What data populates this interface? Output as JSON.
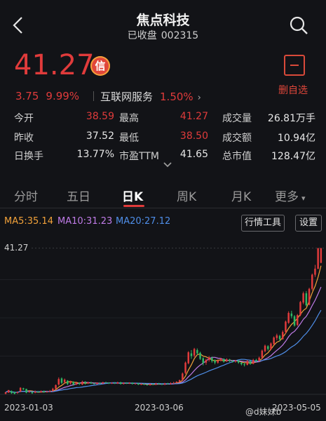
{
  "header": {
    "title": "焦点科技",
    "status": "已收盘",
    "code": "002315"
  },
  "quote": {
    "price": "41.27",
    "badge": "信",
    "change": "3.75",
    "change_pct": "9.99%",
    "sector_name": "互联网服务",
    "sector_pct": "1.50%",
    "sector_arrow": "›"
  },
  "actions": {
    "unfavorite_label": "删自选"
  },
  "stats": {
    "open_label": "今开",
    "open": "38.59",
    "high_label": "最高",
    "high": "41.27",
    "volume_label": "成交量",
    "volume": "26.81万手",
    "prev_label": "昨收",
    "prev": "37.52",
    "low_label": "最低",
    "low": "38.50",
    "amount_label": "成交额",
    "amount": "10.94亿",
    "turnover_label": "日换手",
    "turnover": "13.77%",
    "pe_label": "市盈TTM",
    "pe": "41.65",
    "mcap_label": "总市值",
    "mcap": "128.47亿"
  },
  "tabs": [
    "分时",
    "五日",
    "日K",
    "周K",
    "月K",
    "更多"
  ],
  "tabs_more_arrow": "▾",
  "active_tab": "日K",
  "indicators": {
    "ma5": "MA5:35.14",
    "ma10": "MA10:31.23",
    "ma20": "MA20:27.12"
  },
  "buttons": {
    "tools": "行情工具",
    "settings": "设置"
  },
  "watermark": "@d妹妹b",
  "colors": {
    "up": "#e03b3b",
    "down": "#2fb865",
    "ma5": "#f2a23a",
    "ma10": "#c07ce8",
    "ma20": "#4f8ee8",
    "bg": "#121317"
  },
  "chart_data": {
    "type": "candlestick",
    "price_label_top": "41.27",
    "x_tick_labels": [
      "2023-01-03",
      "2023-03-06",
      "2023-05-05"
    ],
    "ylim": [
      14.5,
      42.5
    ],
    "candles": [
      [
        14.6,
        14.9,
        14.5,
        14.6
      ],
      [
        14.8,
        15.3,
        14.9,
        15.2
      ],
      [
        15.1,
        14.7,
        14.6,
        15.2
      ],
      [
        14.9,
        14.6,
        14.5,
        15.0
      ],
      [
        14.8,
        14.9,
        14.6,
        15.0
      ],
      [
        15.0,
        15.7,
        14.9,
        15.8
      ],
      [
        15.6,
        15.4,
        15.3,
        15.7
      ],
      [
        15.5,
        14.8,
        14.7,
        15.5
      ],
      [
        15.0,
        15.0,
        14.8,
        15.2
      ],
      [
        14.9,
        14.7,
        14.6,
        15.0
      ],
      [
        14.8,
        15.0,
        14.7,
        15.2
      ],
      [
        15.0,
        14.9,
        14.8,
        15.1
      ],
      [
        14.9,
        15.1,
        14.8,
        15.2
      ],
      [
        15.1,
        14.9,
        14.8,
        15.2
      ],
      [
        14.9,
        15.0,
        14.8,
        15.1
      ],
      [
        15.0,
        15.1,
        14.9,
        15.3
      ],
      [
        15.1,
        15.5,
        15.0,
        15.7
      ],
      [
        15.5,
        16.2,
        15.4,
        16.3
      ],
      [
        16.3,
        17.3,
        16.1,
        17.6
      ],
      [
        17.4,
        16.6,
        16.4,
        17.6
      ],
      [
        16.7,
        17.2,
        16.5,
        17.4
      ],
      [
        17.0,
        16.4,
        16.2,
        17.1
      ],
      [
        16.5,
        16.9,
        16.3,
        17.0
      ],
      [
        16.8,
        16.3,
        16.1,
        16.9
      ],
      [
        16.3,
        16.6,
        16.2,
        16.8
      ],
      [
        16.6,
        16.4,
        16.2,
        16.7
      ],
      [
        16.3,
        16.8,
        16.2,
        17.0
      ],
      [
        16.8,
        16.5,
        16.3,
        16.9
      ],
      [
        16.5,
        16.7,
        16.4,
        16.8
      ],
      [
        16.7,
        16.5,
        16.4,
        16.8
      ],
      [
        16.5,
        16.4,
        16.3,
        16.6
      ],
      [
        16.4,
        16.6,
        16.3,
        16.7
      ],
      [
        16.6,
        16.5,
        16.4,
        16.7
      ],
      [
        16.5,
        16.7,
        16.4,
        16.8
      ],
      [
        16.7,
        16.6,
        16.5,
        16.8
      ],
      [
        16.6,
        16.5,
        16.4,
        16.7
      ],
      [
        16.5,
        16.6,
        16.4,
        16.7
      ],
      [
        16.6,
        16.5,
        16.4,
        16.7
      ],
      [
        16.5,
        16.7,
        16.4,
        16.8
      ],
      [
        16.7,
        16.4,
        16.3,
        16.8
      ],
      [
        16.4,
        16.6,
        16.3,
        16.7
      ],
      [
        16.6,
        16.5,
        16.4,
        16.7
      ],
      [
        16.5,
        16.6,
        16.4,
        16.7
      ],
      [
        16.6,
        16.4,
        16.3,
        16.7
      ],
      [
        16.4,
        16.5,
        16.3,
        16.6
      ],
      [
        16.5,
        16.3,
        16.2,
        16.6
      ],
      [
        16.3,
        16.4,
        16.2,
        16.5
      ],
      [
        16.4,
        16.3,
        16.2,
        16.5
      ],
      [
        16.3,
        16.2,
        16.1,
        16.4
      ],
      [
        16.2,
        16.4,
        16.1,
        16.5
      ],
      [
        16.4,
        16.3,
        16.2,
        16.5
      ],
      [
        16.3,
        16.5,
        16.2,
        16.6
      ],
      [
        16.5,
        16.4,
        16.3,
        16.6
      ],
      [
        16.4,
        16.3,
        16.2,
        16.5
      ],
      [
        16.3,
        16.5,
        16.2,
        16.6
      ],
      [
        16.5,
        16.4,
        16.3,
        16.6
      ],
      [
        16.4,
        16.5,
        16.3,
        16.7
      ],
      [
        16.5,
        16.6,
        16.4,
        16.8
      ],
      [
        16.6,
        16.8,
        16.5,
        16.9
      ],
      [
        16.8,
        17.1,
        16.7,
        17.2
      ],
      [
        17.1,
        18.3,
        17.0,
        18.5
      ],
      [
        18.4,
        20.3,
        18.2,
        20.5
      ],
      [
        20.2,
        22.2,
        20.0,
        22.4
      ],
      [
        22.0,
        21.5,
        21.0,
        22.6
      ],
      [
        21.6,
        22.8,
        21.3,
        23.0
      ],
      [
        22.6,
        22.0,
        21.7,
        22.9
      ],
      [
        22.1,
        21.0,
        20.8,
        22.3
      ],
      [
        21.1,
        20.2,
        19.8,
        21.3
      ],
      [
        20.3,
        20.8,
        19.9,
        21.0
      ],
      [
        20.8,
        21.3,
        20.5,
        21.5
      ],
      [
        21.2,
        20.6,
        20.3,
        21.4
      ],
      [
        20.7,
        20.3,
        20.0,
        20.9
      ],
      [
        20.3,
        20.7,
        20.1,
        20.9
      ],
      [
        20.7,
        21.0,
        20.5,
        21.2
      ],
      [
        21.0,
        20.5,
        20.3,
        21.1
      ],
      [
        20.6,
        20.9,
        20.4,
        21.1
      ],
      [
        20.9,
        20.6,
        20.4,
        21.0
      ],
      [
        20.6,
        20.5,
        20.3,
        20.8
      ],
      [
        20.5,
        20.7,
        20.3,
        20.8
      ],
      [
        20.7,
        20.3,
        20.1,
        20.8
      ],
      [
        20.3,
        20.0,
        19.8,
        20.4
      ],
      [
        20.0,
        19.9,
        19.6,
        20.3
      ],
      [
        19.9,
        20.6,
        19.8,
        20.8
      ],
      [
        20.6,
        20.1,
        19.9,
        20.7
      ],
      [
        20.1,
        20.8,
        20.0,
        21.0
      ],
      [
        20.8,
        20.6,
        20.4,
        21.0
      ],
      [
        20.6,
        21.2,
        20.5,
        21.4
      ],
      [
        21.2,
        22.5,
        21.0,
        22.7
      ],
      [
        22.4,
        23.4,
        22.2,
        23.6
      ],
      [
        23.3,
        22.8,
        22.5,
        23.5
      ],
      [
        22.8,
        23.8,
        22.6,
        24.0
      ],
      [
        23.7,
        24.9,
        23.5,
        25.1
      ],
      [
        24.8,
        25.3,
        24.4,
        25.6
      ],
      [
        25.2,
        24.6,
        24.2,
        25.4
      ],
      [
        24.6,
        25.9,
        24.5,
        26.2
      ],
      [
        25.9,
        27.8,
        25.6,
        28.0
      ],
      [
        27.6,
        29.4,
        27.4,
        29.7
      ],
      [
        29.3,
        28.8,
        28.4,
        29.8
      ],
      [
        28.8,
        27.1,
        26.9,
        29.0
      ],
      [
        27.2,
        29.0,
        27.0,
        29.2
      ],
      [
        29.0,
        31.4,
        28.8,
        31.6
      ],
      [
        31.3,
        33.0,
        31.0,
        33.3
      ],
      [
        33.0,
        30.8,
        30.6,
        33.4
      ],
      [
        30.9,
        33.8,
        30.8,
        34.0
      ],
      [
        33.8,
        36.4,
        33.5,
        36.6
      ],
      [
        36.4,
        37.5,
        36.0,
        38.2
      ],
      [
        37.5,
        41.27,
        37.4,
        41.27
      ],
      [
        38.59,
        41.27,
        38.5,
        41.27
      ]
    ],
    "ma_series": [
      {
        "name": "MA5",
        "value_label": "35.14"
      },
      {
        "name": "MA10",
        "value_label": "31.23"
      },
      {
        "name": "MA20",
        "value_label": "27.12"
      }
    ]
  }
}
